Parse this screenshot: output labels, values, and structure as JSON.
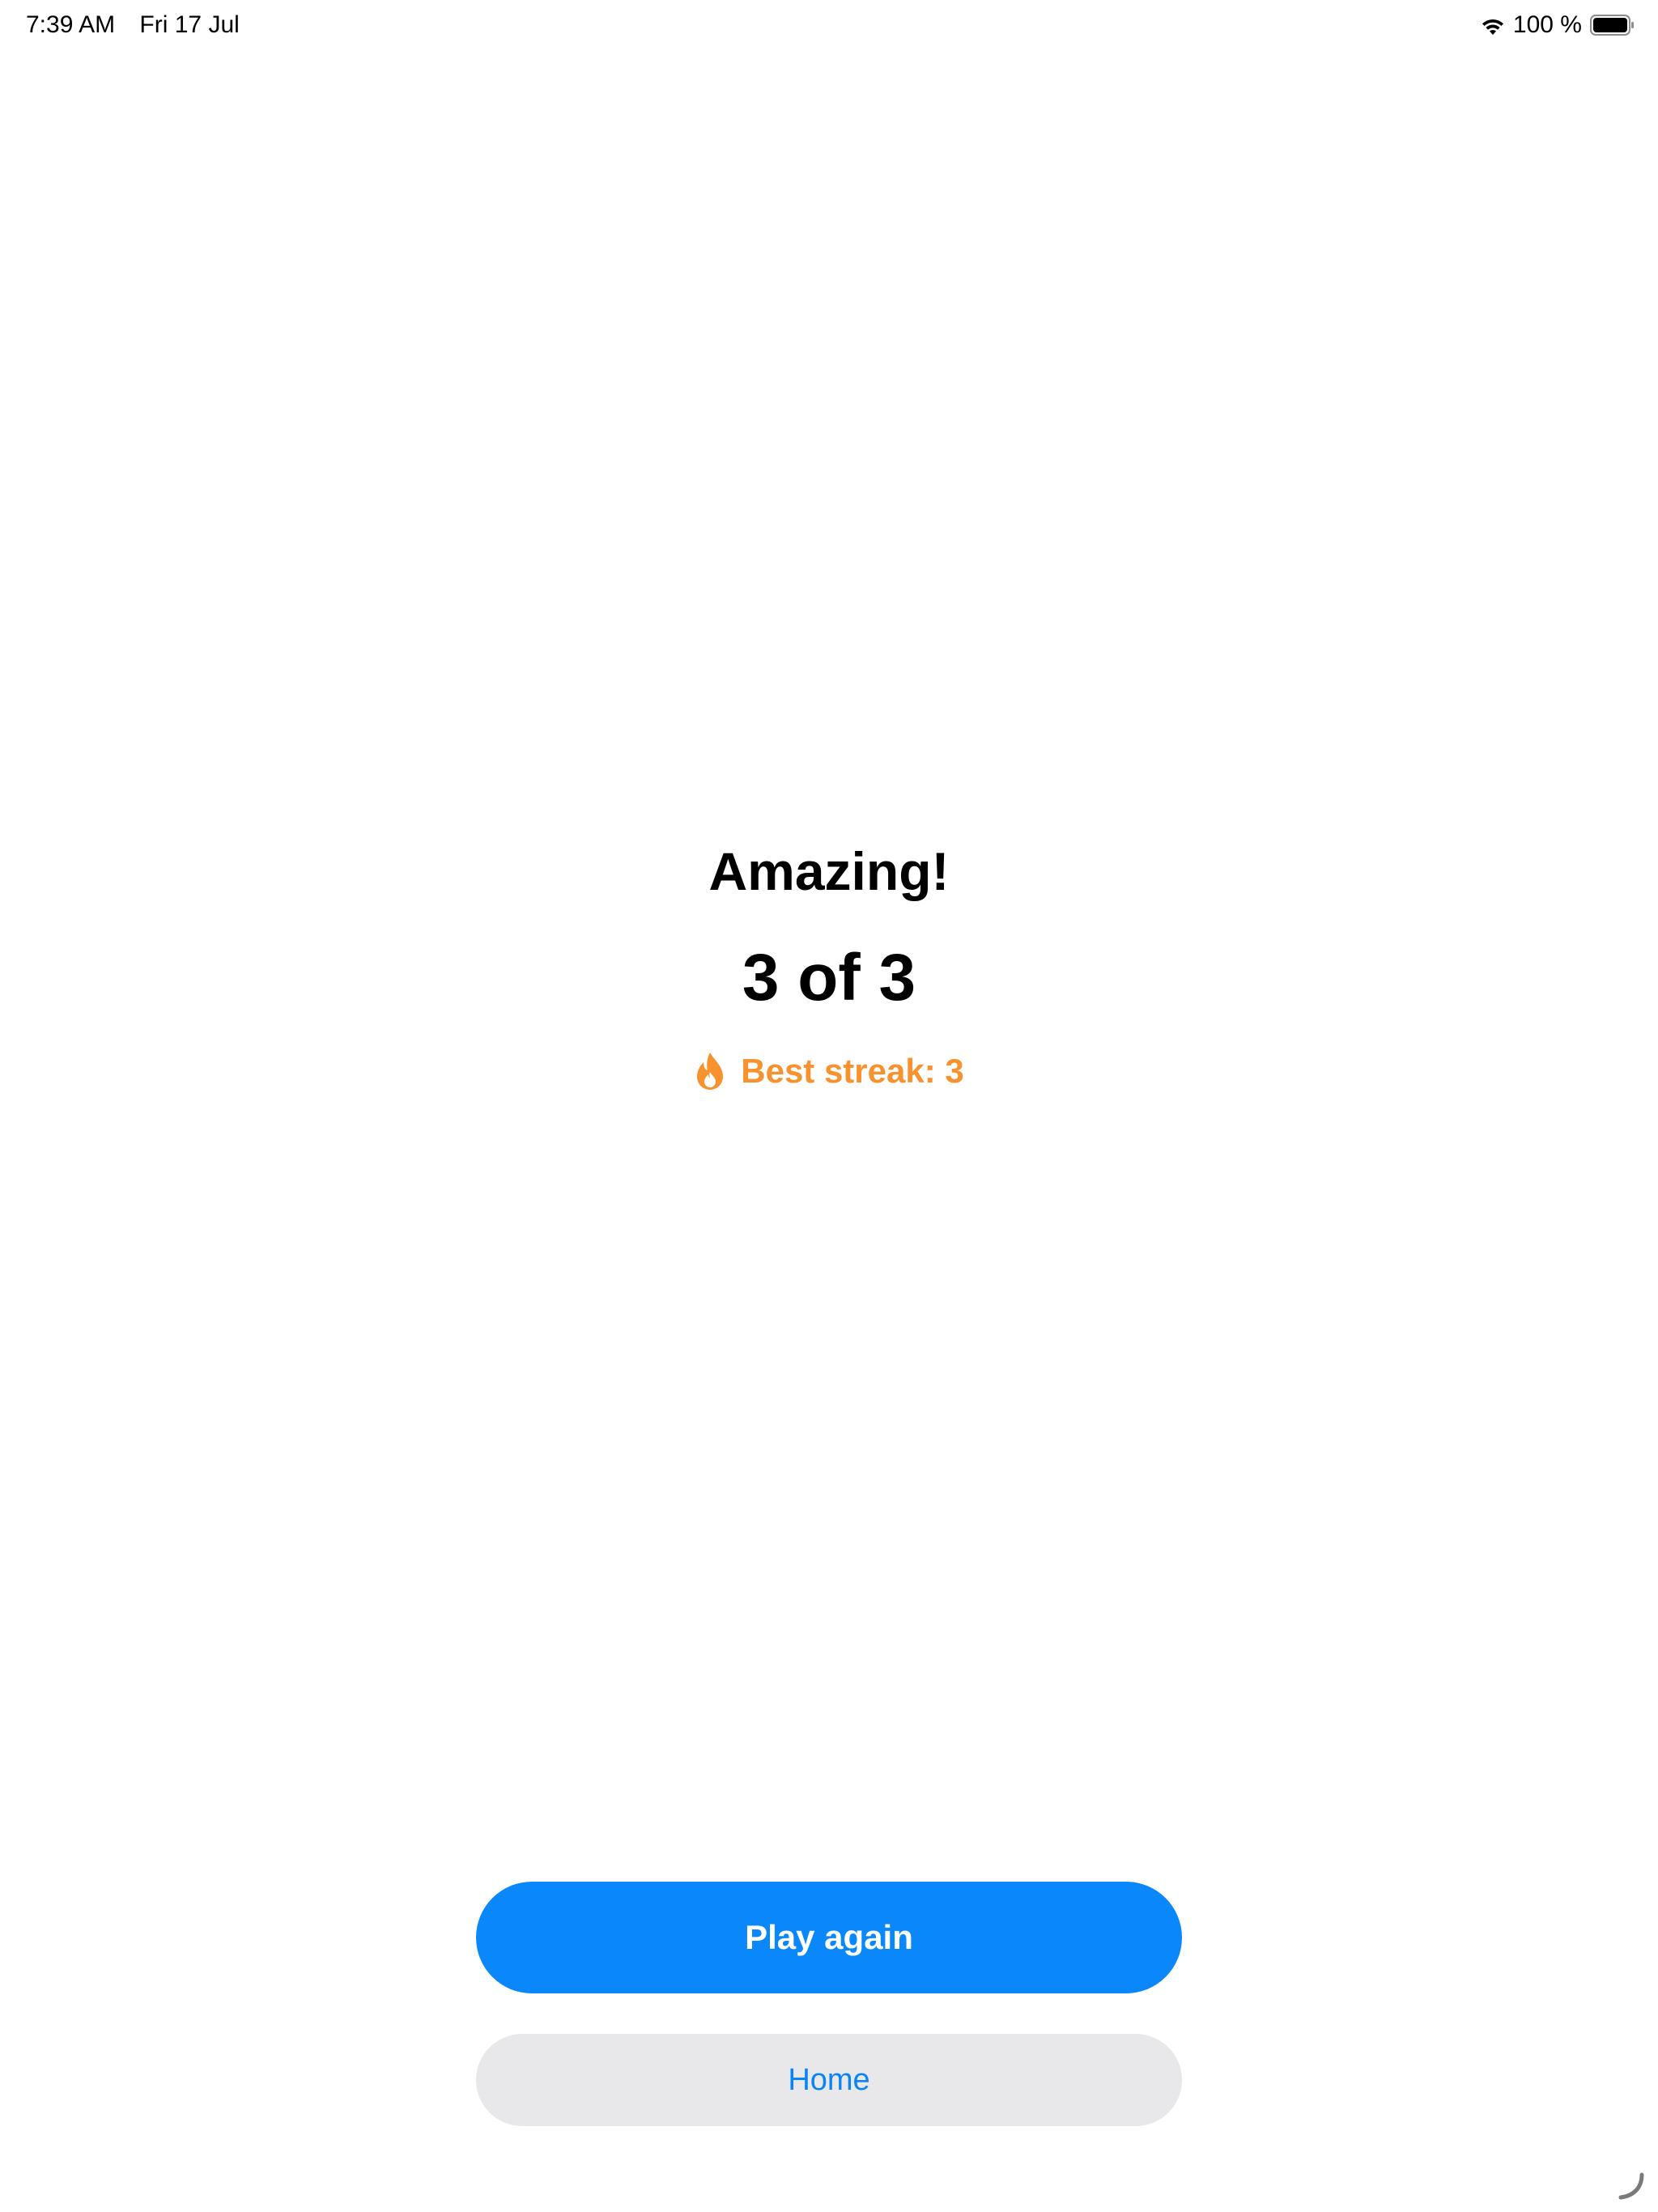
{
  "status_bar": {
    "time": "7:39 AM",
    "date": "Fri 17 Jul",
    "battery_percent": "100 %",
    "icons": [
      "wifi-icon",
      "battery-icon"
    ]
  },
  "result": {
    "headline": "Amazing!",
    "score": "3 of 3",
    "streak_label": "Best streak: 3",
    "streak_icon": "flame-icon",
    "streak_color": "#f7922f"
  },
  "actions": {
    "play_again_label": "Play again",
    "home_label": "Home",
    "primary_color": "#0a88fb",
    "secondary_bg": "#e8e8ea"
  }
}
